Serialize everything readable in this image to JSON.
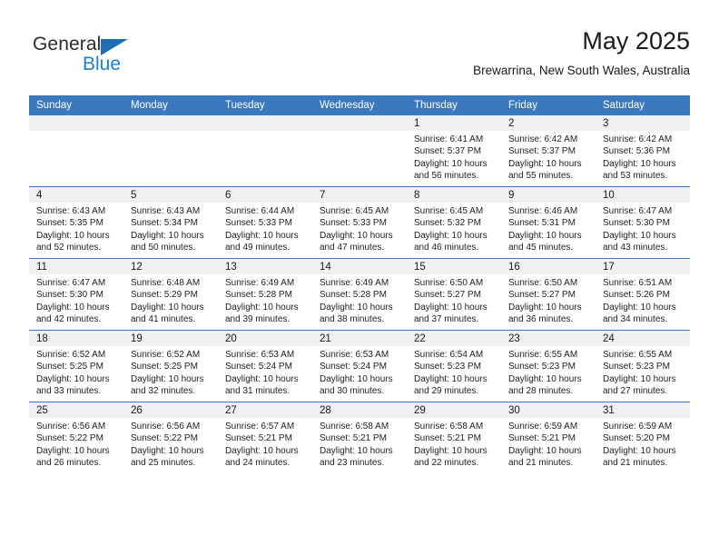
{
  "brand": {
    "word1": "General",
    "word2": "Blue",
    "triangle_color": "#1c6fb5"
  },
  "header": {
    "title": "May 2025",
    "subtitle": "Brewarrina, New South Wales, Australia",
    "header_bg": "#3a79bf",
    "daynum_bg": "#f0f0f0"
  },
  "weekdays": [
    "Sunday",
    "Monday",
    "Tuesday",
    "Wednesday",
    "Thursday",
    "Friday",
    "Saturday"
  ],
  "weeks": [
    [
      {
        "day": "",
        "sunrise": "",
        "sunset": "",
        "daylight1": "",
        "daylight2": ""
      },
      {
        "day": "",
        "sunrise": "",
        "sunset": "",
        "daylight1": "",
        "daylight2": ""
      },
      {
        "day": "",
        "sunrise": "",
        "sunset": "",
        "daylight1": "",
        "daylight2": ""
      },
      {
        "day": "",
        "sunrise": "",
        "sunset": "",
        "daylight1": "",
        "daylight2": ""
      },
      {
        "day": "1",
        "sunrise": "Sunrise: 6:41 AM",
        "sunset": "Sunset: 5:37 PM",
        "daylight1": "Daylight: 10 hours",
        "daylight2": "and 56 minutes."
      },
      {
        "day": "2",
        "sunrise": "Sunrise: 6:42 AM",
        "sunset": "Sunset: 5:37 PM",
        "daylight1": "Daylight: 10 hours",
        "daylight2": "and 55 minutes."
      },
      {
        "day": "3",
        "sunrise": "Sunrise: 6:42 AM",
        "sunset": "Sunset: 5:36 PM",
        "daylight1": "Daylight: 10 hours",
        "daylight2": "and 53 minutes."
      }
    ],
    [
      {
        "day": "4",
        "sunrise": "Sunrise: 6:43 AM",
        "sunset": "Sunset: 5:35 PM",
        "daylight1": "Daylight: 10 hours",
        "daylight2": "and 52 minutes."
      },
      {
        "day": "5",
        "sunrise": "Sunrise: 6:43 AM",
        "sunset": "Sunset: 5:34 PM",
        "daylight1": "Daylight: 10 hours",
        "daylight2": "and 50 minutes."
      },
      {
        "day": "6",
        "sunrise": "Sunrise: 6:44 AM",
        "sunset": "Sunset: 5:33 PM",
        "daylight1": "Daylight: 10 hours",
        "daylight2": "and 49 minutes."
      },
      {
        "day": "7",
        "sunrise": "Sunrise: 6:45 AM",
        "sunset": "Sunset: 5:33 PM",
        "daylight1": "Daylight: 10 hours",
        "daylight2": "and 47 minutes."
      },
      {
        "day": "8",
        "sunrise": "Sunrise: 6:45 AM",
        "sunset": "Sunset: 5:32 PM",
        "daylight1": "Daylight: 10 hours",
        "daylight2": "and 46 minutes."
      },
      {
        "day": "9",
        "sunrise": "Sunrise: 6:46 AM",
        "sunset": "Sunset: 5:31 PM",
        "daylight1": "Daylight: 10 hours",
        "daylight2": "and 45 minutes."
      },
      {
        "day": "10",
        "sunrise": "Sunrise: 6:47 AM",
        "sunset": "Sunset: 5:30 PM",
        "daylight1": "Daylight: 10 hours",
        "daylight2": "and 43 minutes."
      }
    ],
    [
      {
        "day": "11",
        "sunrise": "Sunrise: 6:47 AM",
        "sunset": "Sunset: 5:30 PM",
        "daylight1": "Daylight: 10 hours",
        "daylight2": "and 42 minutes."
      },
      {
        "day": "12",
        "sunrise": "Sunrise: 6:48 AM",
        "sunset": "Sunset: 5:29 PM",
        "daylight1": "Daylight: 10 hours",
        "daylight2": "and 41 minutes."
      },
      {
        "day": "13",
        "sunrise": "Sunrise: 6:49 AM",
        "sunset": "Sunset: 5:28 PM",
        "daylight1": "Daylight: 10 hours",
        "daylight2": "and 39 minutes."
      },
      {
        "day": "14",
        "sunrise": "Sunrise: 6:49 AM",
        "sunset": "Sunset: 5:28 PM",
        "daylight1": "Daylight: 10 hours",
        "daylight2": "and 38 minutes."
      },
      {
        "day": "15",
        "sunrise": "Sunrise: 6:50 AM",
        "sunset": "Sunset: 5:27 PM",
        "daylight1": "Daylight: 10 hours",
        "daylight2": "and 37 minutes."
      },
      {
        "day": "16",
        "sunrise": "Sunrise: 6:50 AM",
        "sunset": "Sunset: 5:27 PM",
        "daylight1": "Daylight: 10 hours",
        "daylight2": "and 36 minutes."
      },
      {
        "day": "17",
        "sunrise": "Sunrise: 6:51 AM",
        "sunset": "Sunset: 5:26 PM",
        "daylight1": "Daylight: 10 hours",
        "daylight2": "and 34 minutes."
      }
    ],
    [
      {
        "day": "18",
        "sunrise": "Sunrise: 6:52 AM",
        "sunset": "Sunset: 5:25 PM",
        "daylight1": "Daylight: 10 hours",
        "daylight2": "and 33 minutes."
      },
      {
        "day": "19",
        "sunrise": "Sunrise: 6:52 AM",
        "sunset": "Sunset: 5:25 PM",
        "daylight1": "Daylight: 10 hours",
        "daylight2": "and 32 minutes."
      },
      {
        "day": "20",
        "sunrise": "Sunrise: 6:53 AM",
        "sunset": "Sunset: 5:24 PM",
        "daylight1": "Daylight: 10 hours",
        "daylight2": "and 31 minutes."
      },
      {
        "day": "21",
        "sunrise": "Sunrise: 6:53 AM",
        "sunset": "Sunset: 5:24 PM",
        "daylight1": "Daylight: 10 hours",
        "daylight2": "and 30 minutes."
      },
      {
        "day": "22",
        "sunrise": "Sunrise: 6:54 AM",
        "sunset": "Sunset: 5:23 PM",
        "daylight1": "Daylight: 10 hours",
        "daylight2": "and 29 minutes."
      },
      {
        "day": "23",
        "sunrise": "Sunrise: 6:55 AM",
        "sunset": "Sunset: 5:23 PM",
        "daylight1": "Daylight: 10 hours",
        "daylight2": "and 28 minutes."
      },
      {
        "day": "24",
        "sunrise": "Sunrise: 6:55 AM",
        "sunset": "Sunset: 5:23 PM",
        "daylight1": "Daylight: 10 hours",
        "daylight2": "and 27 minutes."
      }
    ],
    [
      {
        "day": "25",
        "sunrise": "Sunrise: 6:56 AM",
        "sunset": "Sunset: 5:22 PM",
        "daylight1": "Daylight: 10 hours",
        "daylight2": "and 26 minutes."
      },
      {
        "day": "26",
        "sunrise": "Sunrise: 6:56 AM",
        "sunset": "Sunset: 5:22 PM",
        "daylight1": "Daylight: 10 hours",
        "daylight2": "and 25 minutes."
      },
      {
        "day": "27",
        "sunrise": "Sunrise: 6:57 AM",
        "sunset": "Sunset: 5:21 PM",
        "daylight1": "Daylight: 10 hours",
        "daylight2": "and 24 minutes."
      },
      {
        "day": "28",
        "sunrise": "Sunrise: 6:58 AM",
        "sunset": "Sunset: 5:21 PM",
        "daylight1": "Daylight: 10 hours",
        "daylight2": "and 23 minutes."
      },
      {
        "day": "29",
        "sunrise": "Sunrise: 6:58 AM",
        "sunset": "Sunset: 5:21 PM",
        "daylight1": "Daylight: 10 hours",
        "daylight2": "and 22 minutes."
      },
      {
        "day": "30",
        "sunrise": "Sunrise: 6:59 AM",
        "sunset": "Sunset: 5:21 PM",
        "daylight1": "Daylight: 10 hours",
        "daylight2": "and 21 minutes."
      },
      {
        "day": "31",
        "sunrise": "Sunrise: 6:59 AM",
        "sunset": "Sunset: 5:20 PM",
        "daylight1": "Daylight: 10 hours",
        "daylight2": "and 21 minutes."
      }
    ]
  ]
}
